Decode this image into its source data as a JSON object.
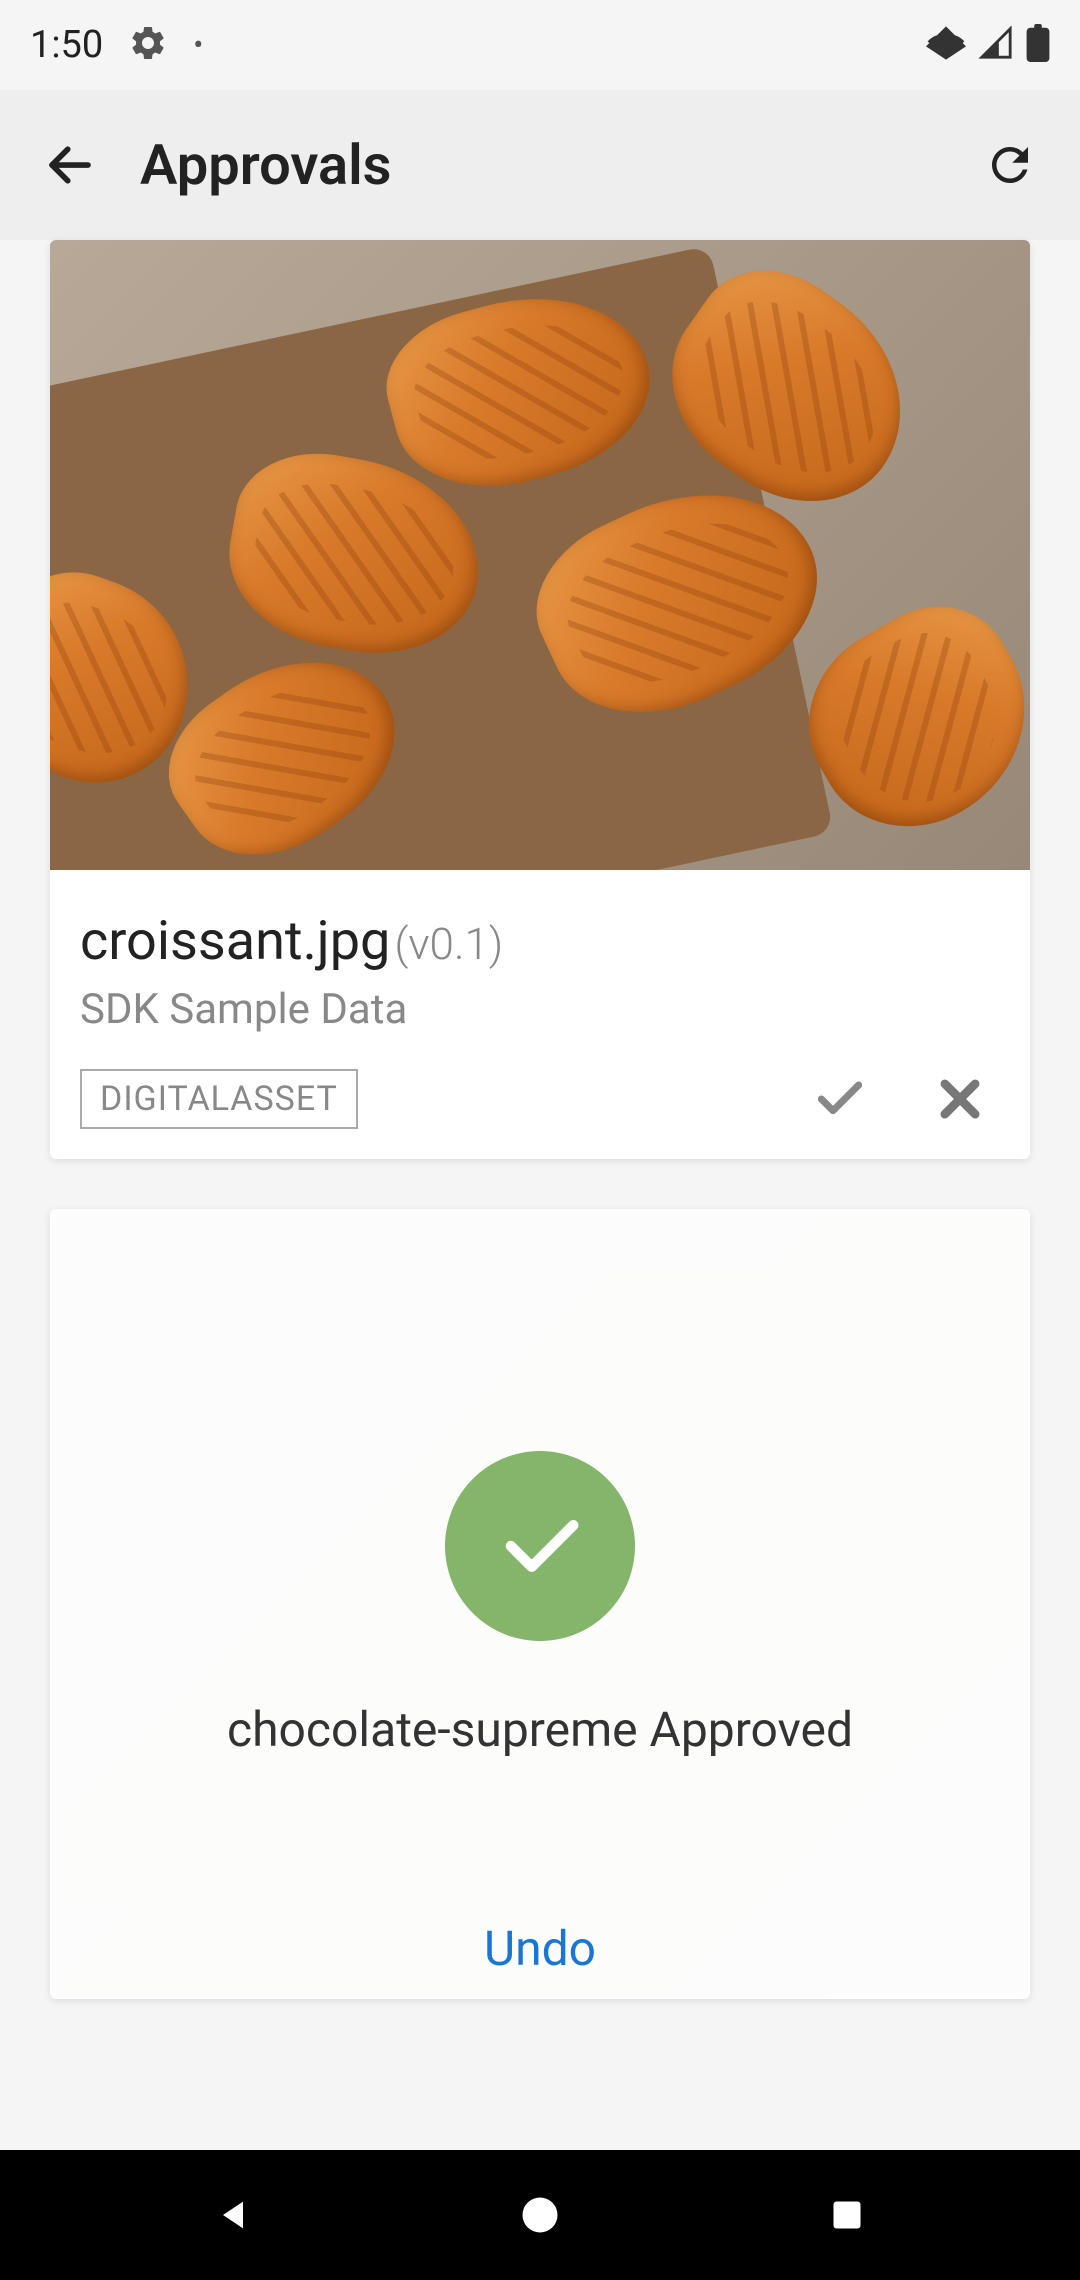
{
  "status_bar": {
    "time": "1:50"
  },
  "header": {
    "title": "Approvals"
  },
  "cards": [
    {
      "filename": "croissant.jpg",
      "version": "(v0.1)",
      "subtitle": "SDK Sample Data",
      "tag": "DIGITALASSET"
    },
    {
      "approved_text": "chocolate-supreme Approved",
      "undo_label": "Undo"
    }
  ]
}
